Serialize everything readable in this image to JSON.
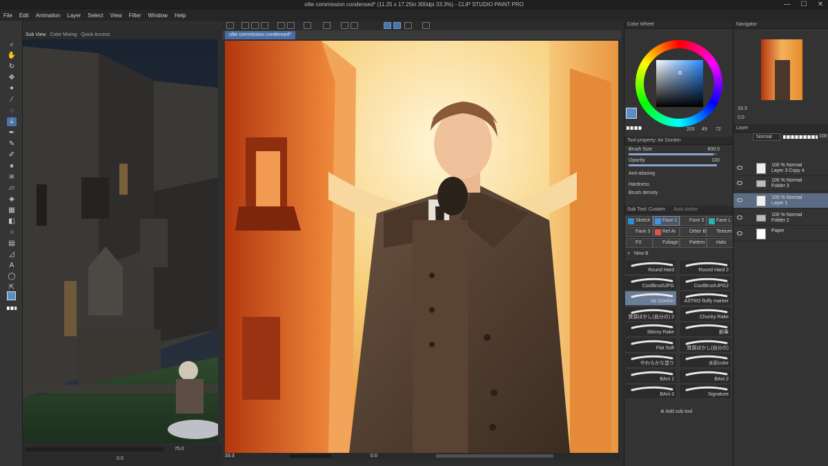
{
  "window": {
    "title": "ollie commission condensed* (11.25 x 17.25in 300dpi 33.3%)  - CLIP STUDIO PAINT PRO",
    "minimize": "—",
    "maximize": "☐",
    "close": "✕"
  },
  "menu": [
    "File",
    "Edit",
    "Animation",
    "Layer",
    "Select",
    "View",
    "Filter",
    "Window",
    "Help"
  ],
  "subview": {
    "tabs": [
      "Sub View",
      "Color Mixing",
      "Quick Access"
    ],
    "zoom": "75.0",
    "rotate": "0.0"
  },
  "canvas": {
    "tab": "ollie commission condensed*",
    "zoom": "33.3",
    "rotate": "0.0"
  },
  "color_wheel": {
    "title": "Color Wheel",
    "h": "203",
    "s": "49",
    "v": "72",
    "main_color": "#5a8fc4"
  },
  "tool_property": {
    "title": "Tool property: Air Gordon",
    "brush_size_label": "Brush Size",
    "brush_size": "600.0",
    "opacity_label": "Opacity",
    "opacity": "100",
    "antialiasing_label": "Anti-aliasing",
    "hardness_label": "Hardness",
    "density_label": "Brush density"
  },
  "subtool": {
    "title": "Sub Tool: Custom",
    "tab2": "Auto Action",
    "groups": [
      {
        "label": "Sketch",
        "color": "#2d8fc7"
      },
      {
        "label": "Fave 1",
        "color": "#4a90e2"
      },
      {
        "label": "Fave 5",
        "color": "#3d3d3d"
      },
      {
        "label": "Fave L",
        "color": "#2ab0b0"
      },
      {
        "label": "Fave 3",
        "color": "#3d3d3d"
      },
      {
        "label": "Ref Ar",
        "color": "#e0524e"
      },
      {
        "label": "Other B",
        "color": "#3d3d3d"
      },
      {
        "label": "Texture",
        "color": "#3d3d3d"
      },
      {
        "label": "FX",
        "color": "#3d3d3d"
      },
      {
        "label": "Foliage",
        "color": "#3d3d3d"
      },
      {
        "label": "Pattern",
        "color": "#3d3d3d"
      },
      {
        "label": "Halo",
        "color": "#3d3d3d"
      }
    ],
    "new_label": "New B",
    "brushes": [
      "Round Hard",
      "Round Hard 2",
      "CoolBrushJPG",
      "CoolBrushJPG2",
      "Air Gordon",
      "ASTRO fluffy marker",
      "質感ぼかし(自分の) 2",
      "Chunky Rake",
      "Skinny Rake",
      "鉛筆",
      "Flat Soft",
      "質感ぼかし(自分の)",
      "やわらかな塗り",
      "水彩color",
      "BAni 1",
      "BAni 2",
      "BAni 3",
      "Signature"
    ],
    "add_label": "Add sub tool"
  },
  "navigator": {
    "title": "Navigator",
    "zoom": "33.3",
    "rotate": "0.0"
  },
  "layer_panel": {
    "title": "Layer",
    "blend": "Normal",
    "opacity": "100",
    "layers": [
      {
        "mode": "100 % Normal",
        "name": "Layer 3 Copy 4"
      },
      {
        "mode": "100 % Normal",
        "name": "Folder 3"
      },
      {
        "mode": "100 % Normal",
        "name": "Layer 1"
      },
      {
        "mode": "100 % Normal",
        "name": "Folder 2"
      },
      {
        "mode": "",
        "name": "Paper"
      }
    ]
  }
}
